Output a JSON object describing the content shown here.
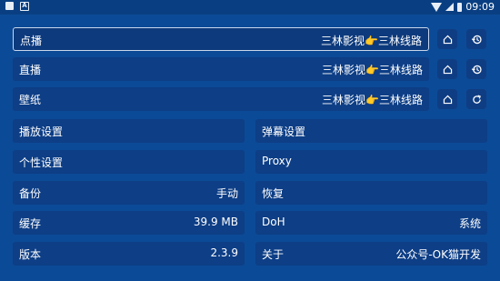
{
  "status_bar": {
    "time": "09:09"
  },
  "site_rows": [
    {
      "label": "点播",
      "value": "三林影视👉三林线路",
      "icon2": "history-icon"
    },
    {
      "label": "直播",
      "value": "三林影视👉三林线路",
      "icon2": "history-icon"
    },
    {
      "label": "壁纸",
      "value": "三林影视👉三林线路",
      "icon2": "refresh-icon"
    }
  ],
  "settings": {
    "play_settings": {
      "label": "播放设置"
    },
    "danmaku_settings": {
      "label": "弹幕设置"
    },
    "personal_settings": {
      "label": "个性设置"
    },
    "proxy": {
      "label": "Proxy"
    },
    "backup": {
      "label": "备份",
      "value": "手动"
    },
    "restore": {
      "label": "恢复"
    },
    "cache": {
      "label": "缓存",
      "value": "39.9 MB"
    },
    "doh": {
      "label": "DoH",
      "value": "系统"
    },
    "version": {
      "label": "版本",
      "value": "2.3.9"
    },
    "about": {
      "label": "关于",
      "value": "公众号-OK猫开发"
    }
  },
  "colors": {
    "background": "#0b4a96",
    "row": "#0d3e86",
    "text": "#ffffff"
  }
}
